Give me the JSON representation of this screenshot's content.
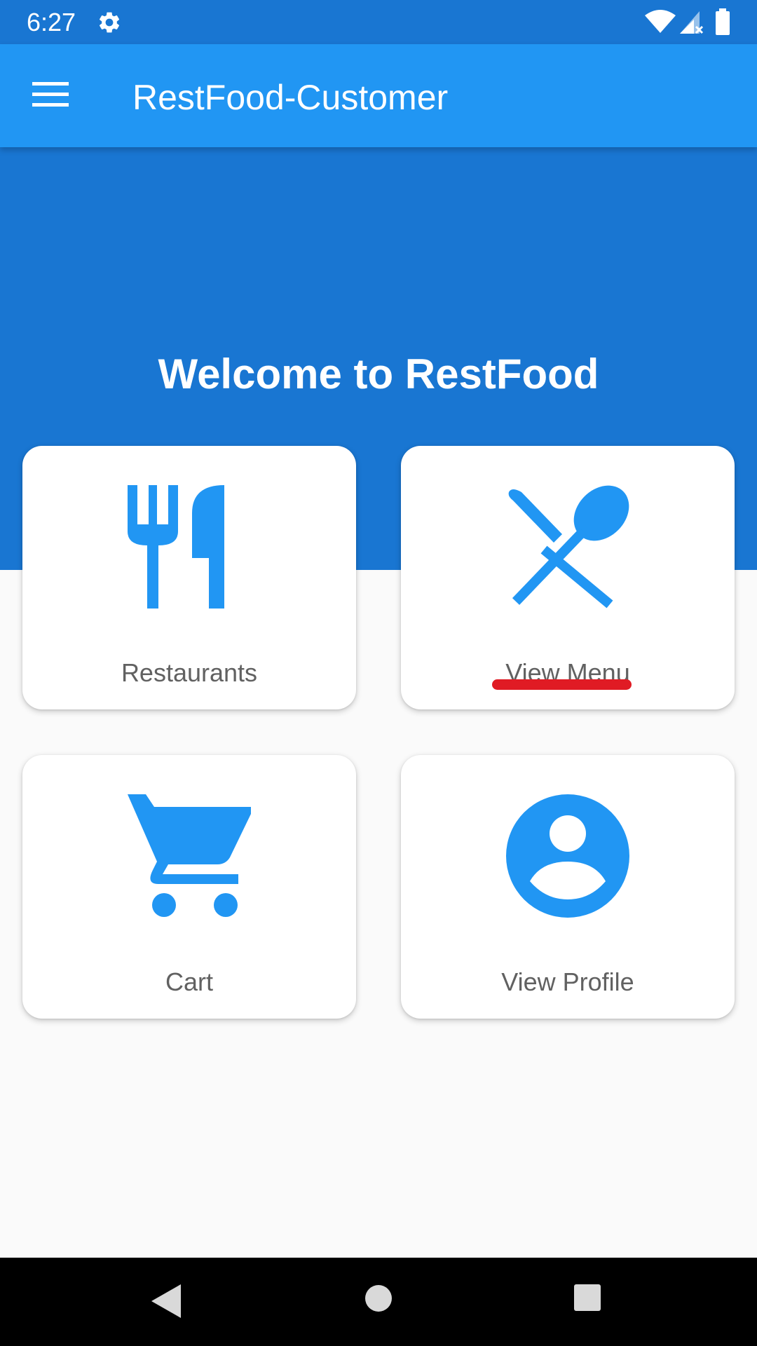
{
  "status_bar": {
    "time": "6:27",
    "icons": [
      "gear-icon",
      "wifi-icon",
      "signal-icon",
      "battery-icon"
    ]
  },
  "app_bar": {
    "title": "RestFood-Customer",
    "menu_icon": "hamburger-menu-icon"
  },
  "hero": {
    "welcome": "Welcome to RestFood"
  },
  "cards": [
    {
      "label": "Restaurants",
      "icon": "fork-knife-icon"
    },
    {
      "label": "View Menu",
      "icon": "utensils-crossed-icon"
    },
    {
      "label": "Cart",
      "icon": "shopping-cart-icon"
    },
    {
      "label": "View Profile",
      "icon": "account-circle-icon"
    }
  ],
  "nav_bar": {
    "icons": [
      "back-icon",
      "home-icon",
      "recents-icon"
    ]
  },
  "colors": {
    "status_bar": "#1976d2",
    "app_bar": "#2196f3",
    "hero": "#1976d2",
    "accent": "#2196f3",
    "annotation": "#e01b24",
    "background": "#fafafa",
    "card_label": "#616161"
  }
}
